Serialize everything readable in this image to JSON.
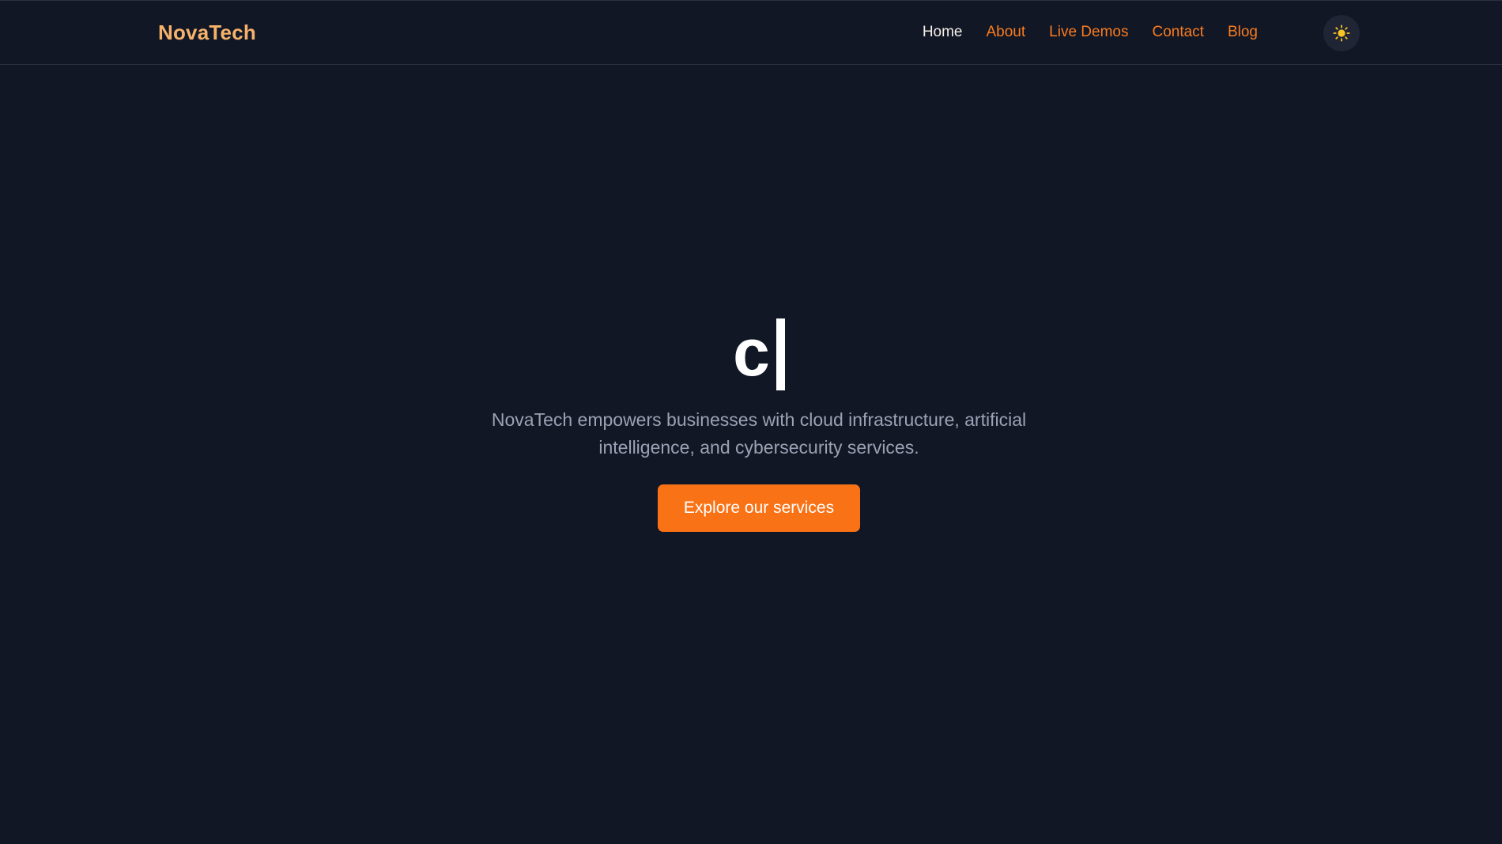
{
  "header": {
    "brand": "NovaTech",
    "nav": [
      {
        "label": "Home",
        "active": true
      },
      {
        "label": "About",
        "active": false
      },
      {
        "label": "Live Demos",
        "active": false
      },
      {
        "label": "Contact",
        "active": false
      },
      {
        "label": "Blog",
        "active": false
      }
    ],
    "theme_toggle_icon": "sun-icon"
  },
  "hero": {
    "title": "c",
    "subtitle": "NovaTech empowers businesses with cloud infrastructure, artificial intelligence, and cybersecurity services.",
    "cta_label": "Explore our services"
  },
  "colors": {
    "background": "#121726",
    "accent": "#f97316",
    "brand": "#f6b26b",
    "nav_link": "#f97c1e",
    "nav_active": "#f3efe6",
    "subtitle": "#9aa2b3",
    "sun": "#f7c325"
  }
}
